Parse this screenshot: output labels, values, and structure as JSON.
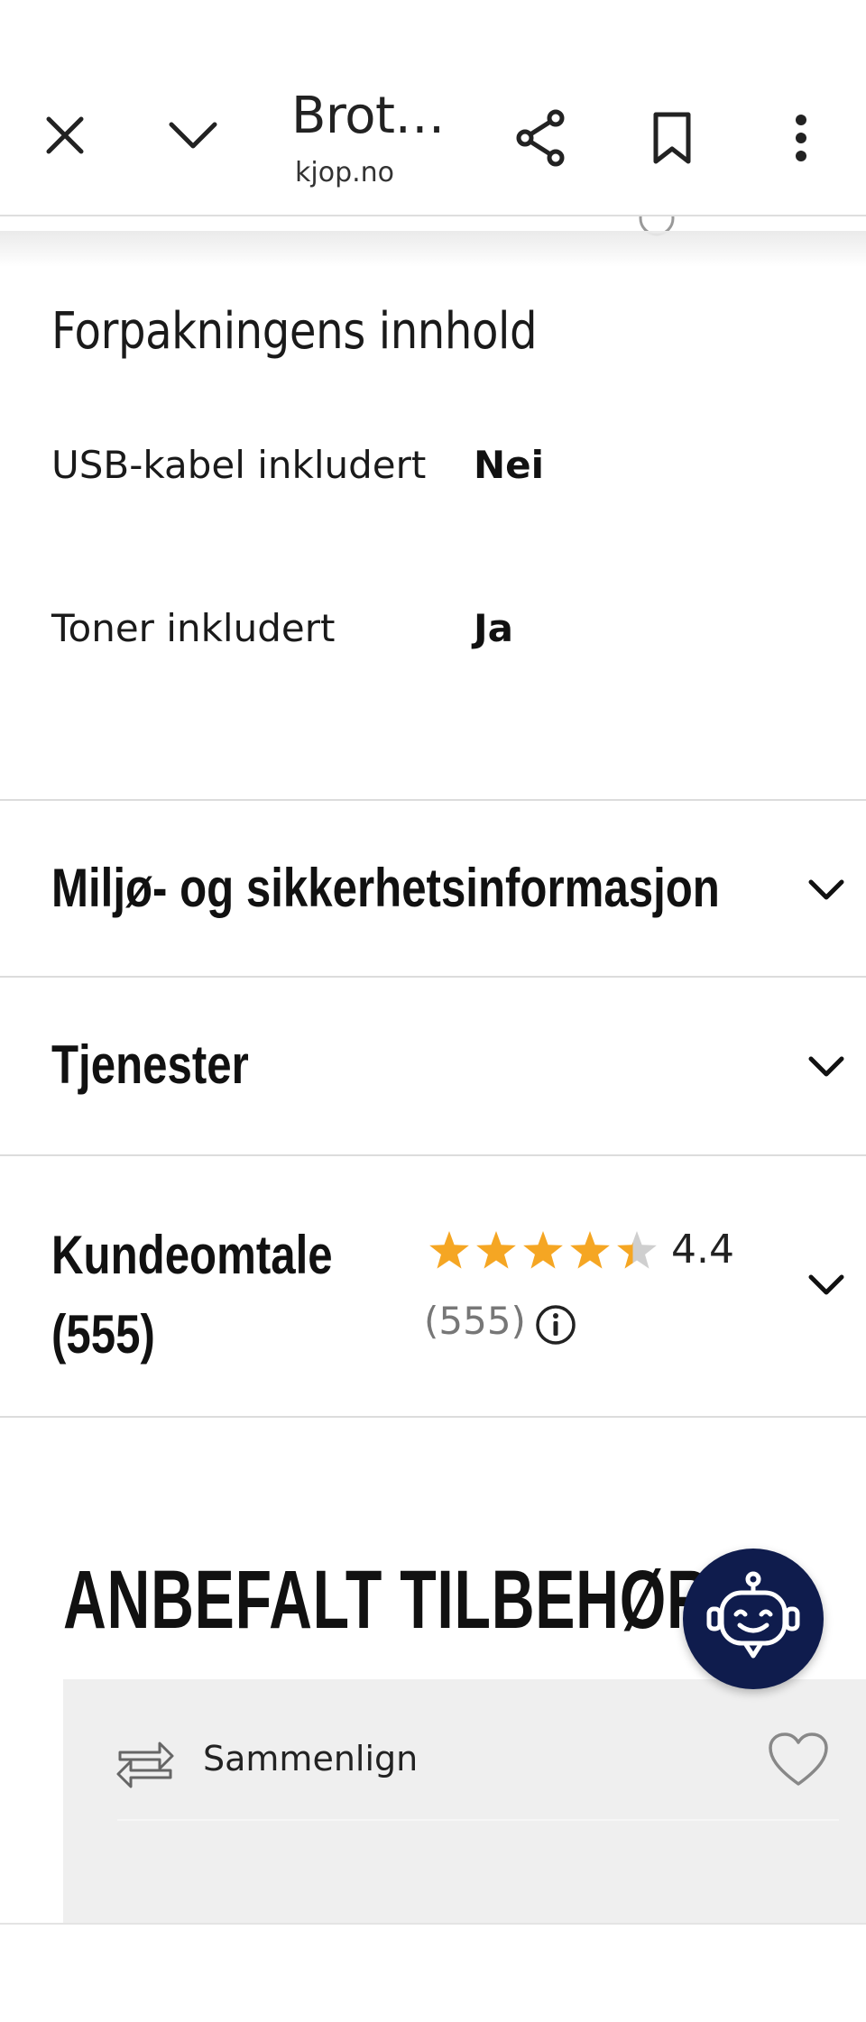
{
  "browser": {
    "title": "Brot…",
    "url": "kjop.no",
    "icons": [
      "close-icon",
      "chevron-down-icon",
      "share-icon",
      "bookmark-icon",
      "more-vert-icon"
    ]
  },
  "contents_section": {
    "title": "Forpakningens innhold",
    "specs": [
      {
        "label": "USB-kabel inkludert",
        "value": "Nei"
      },
      {
        "label": "Toner inkludert",
        "value": "Ja"
      }
    ]
  },
  "accordions": [
    {
      "title": "Miljø- og sikkerhetsinformasjon"
    },
    {
      "title": "Tjenester"
    },
    {
      "title": "Kundeomtale (555)"
    }
  ],
  "rating": {
    "stars": 4.4,
    "max_stars": 5,
    "value_label": "4.4",
    "count_label": "(555)",
    "star_color": "#f5a623"
  },
  "recommended": {
    "heading": "ANBEFALT TILBEHØR",
    "card": {
      "compare_label": "Sammenlign",
      "icons": [
        "compare-arrows-icon",
        "heart-icon"
      ]
    }
  },
  "chatbot": {
    "icon": "robot-chat-icon",
    "color": "#0f1c4d"
  }
}
